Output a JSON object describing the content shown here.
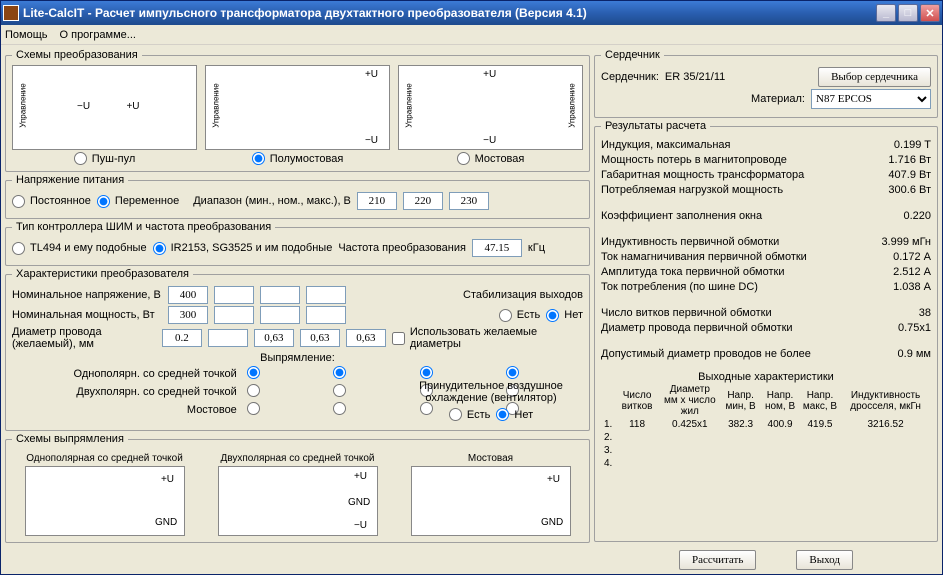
{
  "titlebar": {
    "title": "Lite-CalcIT - Расчет импульсного трансформатора двухтактного преобразователя (Версия 4.1)"
  },
  "menu": {
    "help": "Помощь",
    "about": "О программе..."
  },
  "schemes": {
    "legend": "Схемы  преобразования",
    "pushpull": "Пуш-пул",
    "halfbridge": "Полумостовая",
    "bridge": "Мостовая"
  },
  "supply": {
    "legend": "Напряжение питания",
    "dc": "Постоянное",
    "ac": "Переменное",
    "range_label": "Диапазон (мин., ном., макс.), В",
    "min": "210",
    "nom": "220",
    "max": "230"
  },
  "controller": {
    "legend": "Тип контроллера ШИМ и частота преобразования",
    "tl494": "TL494 и ему подобные",
    "ir2153": "IR2153, SG3525 и им подобные",
    "freq_label": "Частота преобразования",
    "freq": "47.15",
    "freq_unit": "кГц"
  },
  "characteristics": {
    "legend": "Характеристики преобразователя",
    "nom_voltage_label": "Номинальное напряжение, В",
    "nom_voltage": "400",
    "nom_power_label": "Номинальная мощность, Вт",
    "nom_power": "300",
    "wire_dia_label": "Диаметр провода (желаемый), мм",
    "w0": "0.2",
    "w1": "",
    "w2": "0,63",
    "w3": "0,63",
    "w4": "0,63",
    "use_desired": "Использовать желаемые диаметры",
    "stabilization": "Стабилизация выходов",
    "yes": "Есть",
    "no": "Нет",
    "rectification": "Выпрямление:",
    "r1": "Однополярн. со средней точкой",
    "r2": "Двухполярн. со средней точкой",
    "r3": "Мостовое",
    "cooling": "Принудительное воздушное охлаждение (вентилятор)"
  },
  "rect_schemes": {
    "legend": "Схемы выпрямления",
    "s1": "Однополярная со средней точкой",
    "s2": "Двухполярная со средней точкой",
    "s3": "Мостовая"
  },
  "core": {
    "legend": "Сердечник",
    "core_label": "Сердечник:",
    "core_value": "ER 35/21/11",
    "choose": "Выбор сердечника",
    "material_label": "Материал:",
    "material": "N87 EPCOS"
  },
  "results": {
    "legend": "Результаты расчета",
    "rows": [
      {
        "label": "Индукция, максимальная",
        "value": "0.199 T"
      },
      {
        "label": "Мощность потерь в магнитопроводе",
        "value": "1.716 Вт"
      },
      {
        "label": "Габаритная мощность трансформатора",
        "value": "407.9 Вт"
      },
      {
        "label": "Потребляемая нагрузкой мощность",
        "value": "300.6 Вт"
      }
    ],
    "fill": {
      "label": "Коэффициент заполнения окна",
      "value": "0.220"
    },
    "rows2": [
      {
        "label": "Индуктивность первичной обмотки",
        "value": "3.999 мГн"
      },
      {
        "label": "Ток намагничивания первичной обмотки",
        "value": "0.172 А"
      },
      {
        "label": "Амплитуда тока первичной обмотки",
        "value": "2.512 А"
      },
      {
        "label": "Ток потребления (по шине DC)",
        "value": "1.038 А"
      }
    ],
    "rows3": [
      {
        "label": "Число витков первичной обмотки",
        "value": "38"
      },
      {
        "label": "Диаметр провода первичной обмотки",
        "value": "0.75x1"
      }
    ],
    "max_d": {
      "label": "Допустимый диаметр проводов не более",
      "value": "0.9 мм"
    },
    "out_legend": "Выходные характеристики",
    "out_headers": [
      "",
      "Число витков",
      "Диаметр мм x число жил",
      "Напр. мин, В",
      "Напр. ном, В",
      "Напр. макс, В",
      "Индуктивность дросселя, мкГн"
    ],
    "out_rows": [
      [
        "1.",
        "118",
        "0.425x1",
        "382.3",
        "400.9",
        "419.5",
        "3216.52"
      ],
      [
        "2.",
        "",
        "",
        "",
        "",
        "",
        ""
      ],
      [
        "3.",
        "",
        "",
        "",
        "",
        "",
        ""
      ],
      [
        "4.",
        "",
        "",
        "",
        "",
        "",
        ""
      ]
    ]
  },
  "buttons": {
    "calc": "Рассчитать",
    "exit": "Выход"
  }
}
